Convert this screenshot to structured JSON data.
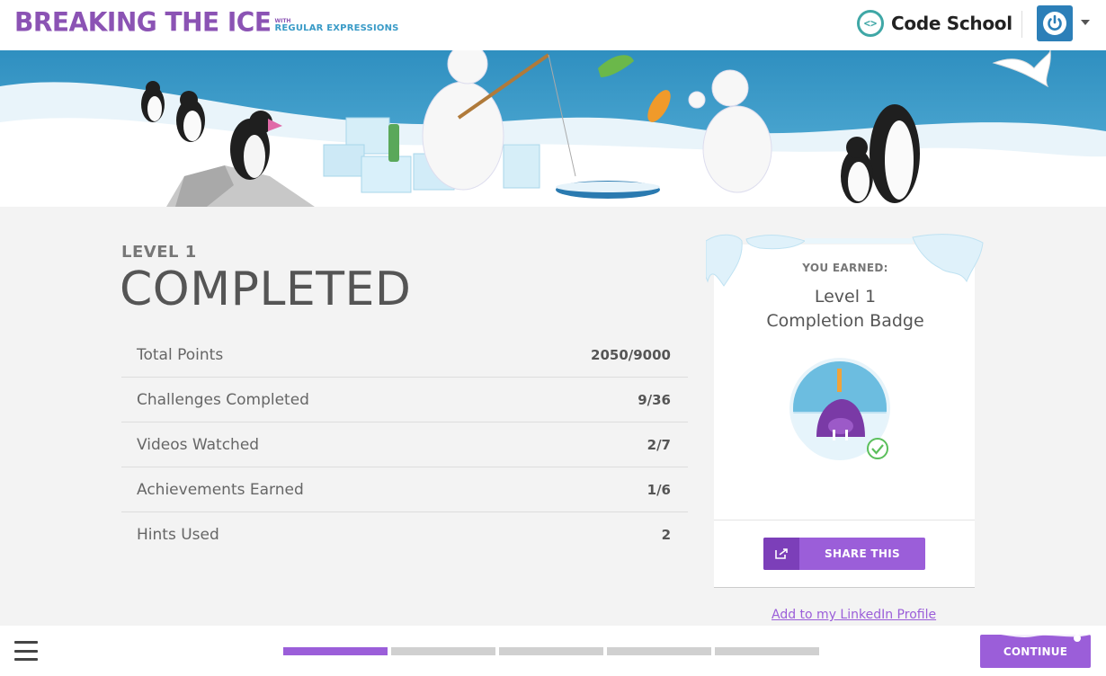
{
  "header": {
    "logo_main": "BREAKING THE ICE",
    "logo_with": "WITH",
    "logo_sub": "REGULAR EXPRESSIONS",
    "brand_name": "Code School",
    "brand_icon": "code-brackets-icon",
    "account_icon": "power-icon"
  },
  "level": {
    "label": "LEVEL 1",
    "status": "COMPLETED"
  },
  "stats": [
    {
      "label": "Total Points",
      "value": "2050/9000"
    },
    {
      "label": "Challenges Completed",
      "value": "9/36"
    },
    {
      "label": "Videos Watched",
      "value": "2/7"
    },
    {
      "label": "Achievements Earned",
      "value": "1/6"
    },
    {
      "label": "Hints Used",
      "value": "2"
    }
  ],
  "badge": {
    "earned_label": "YOU EARNED:",
    "title_line1": "Level 1",
    "title_line2": "Completion Badge",
    "badge_number": "1",
    "share_label": "SHARE THIS",
    "linkedin_label": "Add to my LinkedIn Profile"
  },
  "footer": {
    "continue_label": "CONTINUE",
    "levels_total": 5,
    "levels_completed": 1
  },
  "colors": {
    "accent_purple": "#9b5ed9",
    "accent_purple_dark": "#7c3fb9",
    "brand_teal": "#3fa7a6",
    "account_blue": "#2c7fb8",
    "sky_blue": "#3a9bc7"
  }
}
